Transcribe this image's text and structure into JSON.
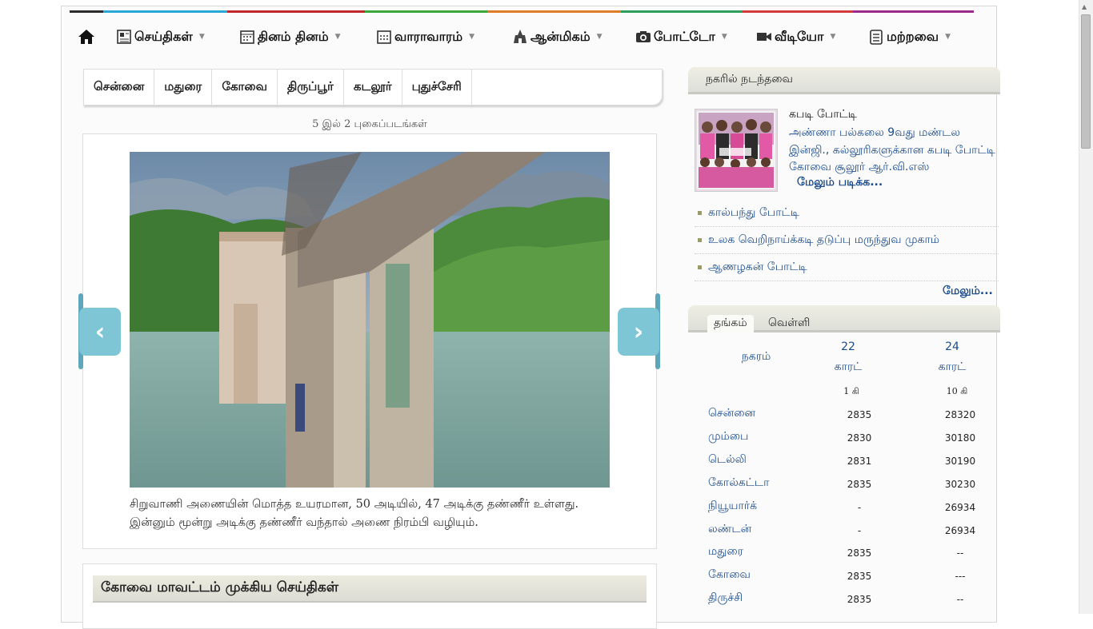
{
  "colors": {
    "topbar": [
      "#2b2b2b",
      "#29a7d6",
      "#c0272d",
      "#39a83a",
      "#e07b27",
      "#2d9e5c",
      "#d33a3a",
      "#9a2a8a"
    ],
    "link": "#1a4b8c",
    "arrow": "#7ec6d6"
  },
  "nav": {
    "home_icon": "home-icon",
    "items": [
      {
        "label": "செய்திகள்",
        "icon": "newspaper-icon"
      },
      {
        "label": "தினம் தினம்",
        "icon": "calendar-icon"
      },
      {
        "label": "வாராவாரம்",
        "icon": "weekly-calendar-icon"
      },
      {
        "label": "ஆன்மிகம்",
        "icon": "temple-icon"
      },
      {
        "label": "போட்டோ",
        "icon": "camera-icon"
      },
      {
        "label": "வீடியோ",
        "icon": "video-icon"
      },
      {
        "label": "மற்றவை",
        "icon": "document-icon"
      }
    ]
  },
  "subnav": [
    "சென்னை",
    "மதுரை",
    "கோவை",
    "திருப்பூர்",
    "கடலூர்",
    "புதுச்சேரி"
  ],
  "gallery": {
    "count_text": "5 இல் 2 புகைப்படங்கள்",
    "caption": "சிறுவாணி அணையின் மொத்த உயரமான, 50 அடியில், 47 அடிக்கு தண்ணீர் உள்ளது. இன்னும் மூன்று அடிக்கு தண்ணீர் வந்தால் அணை நிரம்பி வழியும்.",
    "prev_symbol": "‹",
    "next_symbol": "›"
  },
  "district_news": {
    "title": "கோவை மாவட்டம் முக்கிய செய்திகள்"
  },
  "city_events": {
    "title": "நகரில் நடந்தவை",
    "featured": {
      "title": "கபடி போட்டி",
      "desc": "அண்ணா பல்கலை 9வது மண்டல இன்ஜி., கல்லூரிகளுக்கான கபடி போட்டி கோவை சூலூர் ஆர்.வி.எஸ்",
      "more": "மேலும் படிக்க..."
    },
    "items": [
      "கால்பந்து போட்டி",
      "உலக வெறிநாய்க்கடி தடுப்பு மருந்துவ முகாம்",
      "ஆணழகன் போட்டி"
    ],
    "more": "மேலும்..."
  },
  "rates": {
    "tabs": [
      "தங்கம்",
      "வெள்ளி"
    ],
    "header": {
      "city": "நகரம்",
      "c22": "22",
      "c22unit": "காரட்",
      "c24": "24",
      "c24unit": "காரட்",
      "u22": "1 கி",
      "u24": "10 கி"
    },
    "rows": [
      {
        "city": "சென்னை",
        "v22": "2835",
        "v24": "28320"
      },
      {
        "city": "மும்பை",
        "v22": "2830",
        "v24": "30180"
      },
      {
        "city": "டெல்லி",
        "v22": "2831",
        "v24": "30190"
      },
      {
        "city": "கோல்கட்டா",
        "v22": "2835",
        "v24": "30230"
      },
      {
        "city": "நியூயார்க்",
        "v22": "-",
        "v24": "26934"
      },
      {
        "city": "லண்டன்",
        "v22": "-",
        "v24": "26934"
      },
      {
        "city": "மதுரை",
        "v22": "2835",
        "v24": "--"
      },
      {
        "city": "கோவை",
        "v22": "2835",
        "v24": "---"
      },
      {
        "city": "திருச்சி",
        "v22": "2835",
        "v24": "--"
      }
    ]
  }
}
